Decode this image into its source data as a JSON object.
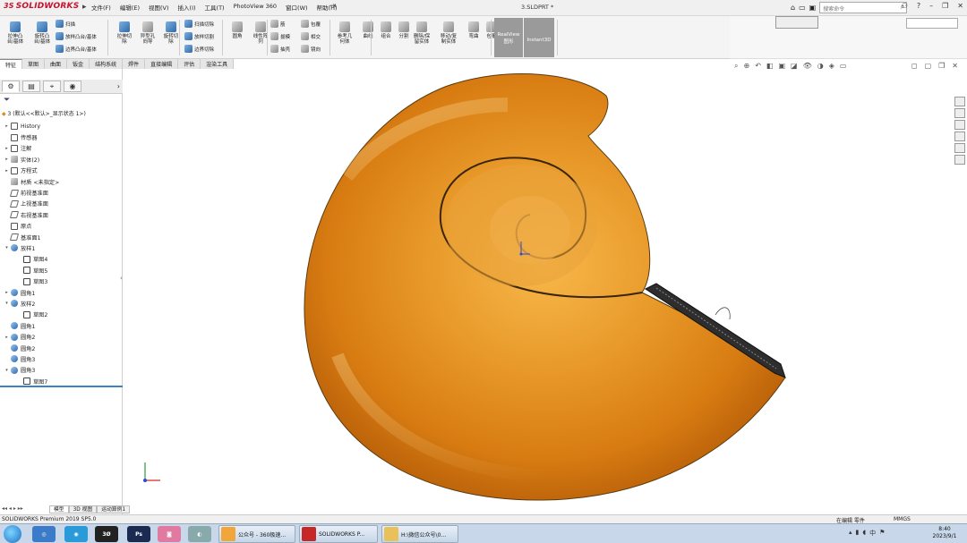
{
  "app": {
    "logo_text": "SOLIDWORKS",
    "doc_title": "3.SLDPRT *",
    "menus": [
      "文件(F)",
      "编辑(E)",
      "视图(V)",
      "插入(I)",
      "工具(T)",
      "PhotoView 360",
      "窗口(W)",
      "帮助(H)"
    ],
    "search_placeholder": "搜索命令"
  },
  "command_manager": {
    "big_buttons": [
      {
        "label": "拉伸凸\n台/基体",
        "icon": "extrude-boss-icon"
      },
      {
        "label": "旋转凸\n台/基体",
        "icon": "revolve-boss-icon"
      },
      {
        "label": "拉伸切\n除",
        "icon": "extrude-cut-icon"
      },
      {
        "label": "异型孔\n向导",
        "icon": "hole-wizard-icon"
      },
      {
        "label": "旋转切\n除",
        "icon": "revolve-cut-icon"
      },
      {
        "label": "圆角",
        "icon": "fillet-icon"
      },
      {
        "label": "线性阵\n列",
        "icon": "linear-pattern-icon"
      },
      {
        "label": "参考几\n何体",
        "icon": "reference-geometry-icon"
      },
      {
        "label": "曲线",
        "icon": "curves-icon"
      },
      {
        "label": "组合",
        "icon": "combine-icon"
      },
      {
        "label": "分割",
        "icon": "split-icon"
      },
      {
        "label": "删除/保\n留实体",
        "icon": "delete-body-icon"
      },
      {
        "label": "移动/复\n制实体",
        "icon": "move-copy-icon"
      },
      {
        "label": "弯曲",
        "icon": "flex-icon"
      },
      {
        "label": "包覆",
        "icon": "wrap-icon"
      }
    ],
    "small_buttons": [
      "扫描",
      "放样凸台/基体",
      "边界凸台/基体",
      "扫描切除",
      "放样切割",
      "边界切除",
      "筋",
      "拔模",
      "抽壳",
      "包覆",
      "相交",
      "镜向"
    ],
    "realview_label": "RealView\n图形",
    "instant3d_label": "Instant3D"
  },
  "tabs": [
    "特征",
    "草图",
    "曲面",
    "钣金",
    "结构系统",
    "焊件",
    "直接编辑",
    "评估",
    "渲染工具"
  ],
  "active_tab": "特征",
  "tree": {
    "root": "3 (默认<<默认>_显示状态 1>)",
    "nodes": [
      {
        "label": "History",
        "indent": 0,
        "arrow": "▸",
        "icon": "history"
      },
      {
        "label": "传感器",
        "indent": 0,
        "arrow": "",
        "icon": "sensor"
      },
      {
        "label": "注解",
        "indent": 0,
        "arrow": "▸",
        "icon": "annotation"
      },
      {
        "label": "实体(2)",
        "indent": 0,
        "arrow": "▸",
        "icon": "solid"
      },
      {
        "label": "方程式",
        "indent": 0,
        "arrow": "▸",
        "icon": "equation"
      },
      {
        "label": "材质 <未指定>",
        "indent": 0,
        "arrow": "",
        "icon": "material"
      },
      {
        "label": "前视基准面",
        "indent": 0,
        "arrow": "",
        "icon": "plane"
      },
      {
        "label": "上视基准面",
        "indent": 0,
        "arrow": "",
        "icon": "plane"
      },
      {
        "label": "右视基准面",
        "indent": 0,
        "arrow": "",
        "icon": "plane"
      },
      {
        "label": "原点",
        "indent": 0,
        "arrow": "",
        "icon": "origin"
      },
      {
        "label": "基准面1",
        "indent": 0,
        "arrow": "",
        "icon": "plane"
      },
      {
        "label": "放样1",
        "indent": 0,
        "arrow": "▾",
        "icon": "loft"
      },
      {
        "label": "草图4",
        "indent": 1,
        "arrow": "",
        "icon": "sketch"
      },
      {
        "label": "草图5",
        "indent": 1,
        "arrow": "",
        "icon": "sketch"
      },
      {
        "label": "草图3",
        "indent": 1,
        "arrow": "",
        "icon": "sketch"
      },
      {
        "label": "圆角1",
        "indent": 0,
        "arrow": "▸",
        "icon": "fillet"
      },
      {
        "label": "放样2",
        "indent": 0,
        "arrow": "▾",
        "icon": "loft"
      },
      {
        "label": "草图2",
        "indent": 1,
        "arrow": "",
        "icon": "sketch"
      },
      {
        "label": "圆角1",
        "indent": 0,
        "arrow": "",
        "icon": "fillet"
      },
      {
        "label": "圆角2",
        "indent": 0,
        "arrow": "▸",
        "icon": "fillet"
      },
      {
        "label": "圆角2",
        "indent": 0,
        "arrow": "",
        "icon": "fillet"
      },
      {
        "label": "圆角3",
        "indent": 0,
        "arrow": "",
        "icon": "fillet"
      },
      {
        "label": "圆角3",
        "indent": 0,
        "arrow": "▾",
        "icon": "fillet"
      },
      {
        "label": "草图7",
        "indent": 1,
        "arrow": "",
        "icon": "sketch"
      }
    ]
  },
  "bottom_tabs": [
    "模型",
    "3D 视图",
    "运动算例1"
  ],
  "status": {
    "left": "SOLIDWORKS Premium 2019 SP5.0",
    "editing": "在编辑 零件",
    "units": "MMGS"
  },
  "taskbar": {
    "apps": [
      {
        "label": "公众号 - 360极速...",
        "color": "#f2a53a"
      },
      {
        "label": "SOLIDWORKS P...",
        "color": "#c62828"
      },
      {
        "label": "H:\\微信公众号\\0...",
        "color": "#e8c15a"
      }
    ],
    "time": "8:40",
    "date": "2023/9/1"
  },
  "colors": {
    "accent": "#c8102e",
    "model_gold": "#e89a2a",
    "tree_highlight": "#3a82c8"
  }
}
